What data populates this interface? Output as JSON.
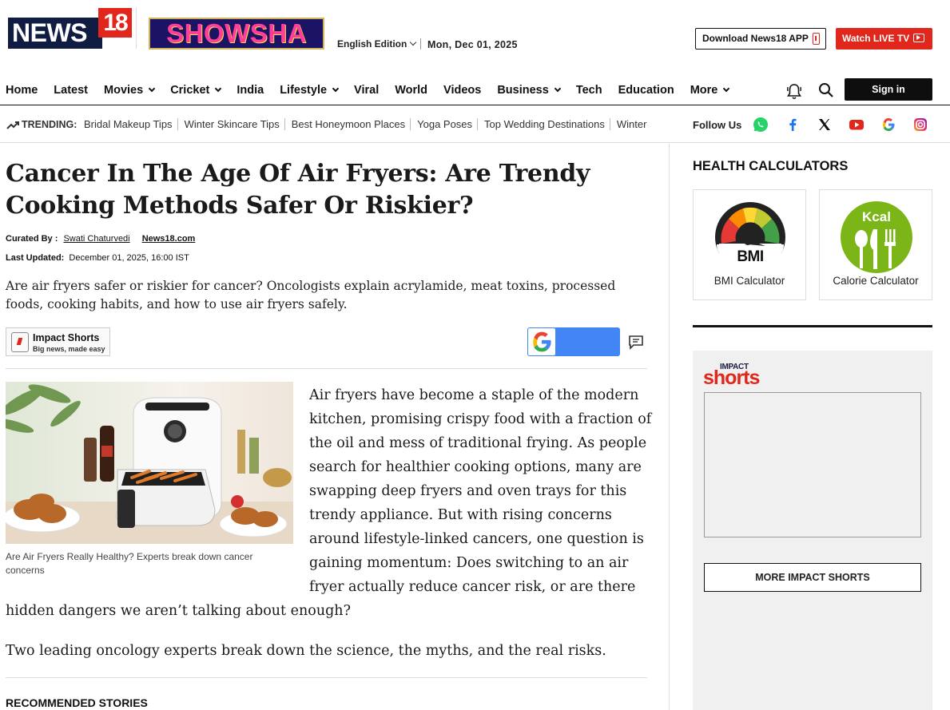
{
  "header": {
    "brand_logo_text": "NEWS18",
    "partner_logo_text": "SHOWSHA",
    "edition": "English Edition",
    "date": "Mon, Dec 01, 2025",
    "download_app": "Download News18 APP",
    "watch_live": "Watch LIVE TV"
  },
  "nav": {
    "items": [
      {
        "label": "Home",
        "dropdown": false
      },
      {
        "label": "Latest",
        "dropdown": false
      },
      {
        "label": "Movies",
        "dropdown": true
      },
      {
        "label": "Cricket",
        "dropdown": true
      },
      {
        "label": "India",
        "dropdown": false
      },
      {
        "label": "Lifestyle",
        "dropdown": true
      },
      {
        "label": "Viral",
        "dropdown": false
      },
      {
        "label": "World",
        "dropdown": false
      },
      {
        "label": "Videos",
        "dropdown": false
      },
      {
        "label": "Business",
        "dropdown": true
      },
      {
        "label": "Tech",
        "dropdown": false
      },
      {
        "label": "Education",
        "dropdown": false
      },
      {
        "label": "More",
        "dropdown": true
      }
    ],
    "sign_in": "Sign in"
  },
  "trending": {
    "label": "TRENDING:",
    "items": [
      "Bridal Makeup Tips",
      "Winter Skincare Tips",
      "Best Honeymoon Places",
      "Yoga Poses",
      "Top Wedding Destinations",
      "Winter"
    ],
    "follow_label": "Follow Us",
    "social": [
      "whatsapp-icon",
      "facebook-icon",
      "x-icon",
      "youtube-icon",
      "google-icon",
      "instagram-icon"
    ]
  },
  "article": {
    "headline": "Cancer In The Age Of Air Fryers: Are Trendy Cooking Methods Safer Or Riskier?",
    "curated_label": "Curated By :",
    "author": "Swati Chaturvedi",
    "publisher": "News18.com",
    "updated_label": "Last Updated:",
    "updated": "December 01, 2025, 16:00 IST",
    "summary": "Are air fryers safer or riskier for cancer? Oncologists explain acrylamide, meat toxins, processed foods, cooking habits, and how to use air fryers safely.",
    "impact_title": "Impact Shorts",
    "impact_sub": "Big news, made easy",
    "image_caption": "Are Air Fryers Really Healthy? Experts break down cancer concerns",
    "body_wrapped": "Air fryers have become a staple of the modern kitchen, promising crispy food with a fraction of the oil and mess of traditional frying. As people search for healthier cooking options, many are swapping deep fryers and oven trays for this trendy appliance. But with rising concerns around lifestyle-linked cancers, one question is gaining momentum: Does switching to an air fryer actually reduce cancer risk, or are there",
    "body_tail": "hidden dangers we aren’t talking about enough?",
    "body_p2": "Two leading oncology experts break down the science, the myths, and the real risks.",
    "recommended": "RECOMMENDED STORIES"
  },
  "sidebar": {
    "calculators_title": "HEALTH CALCULATORS",
    "calculators": [
      {
        "label": "BMI Calculator",
        "badge": "BMI"
      },
      {
        "label": "Calorie Calculator",
        "badge": "Kcal"
      }
    ],
    "impact_logo_top": "IMPACT",
    "impact_logo": "shorts",
    "more_impact": "MORE IMPACT SHORTS"
  },
  "colors": {
    "brand_red": "#e1261c",
    "navy": "#111c43",
    "google_blue": "#4285f4",
    "calorie_green": "#7cb518"
  }
}
